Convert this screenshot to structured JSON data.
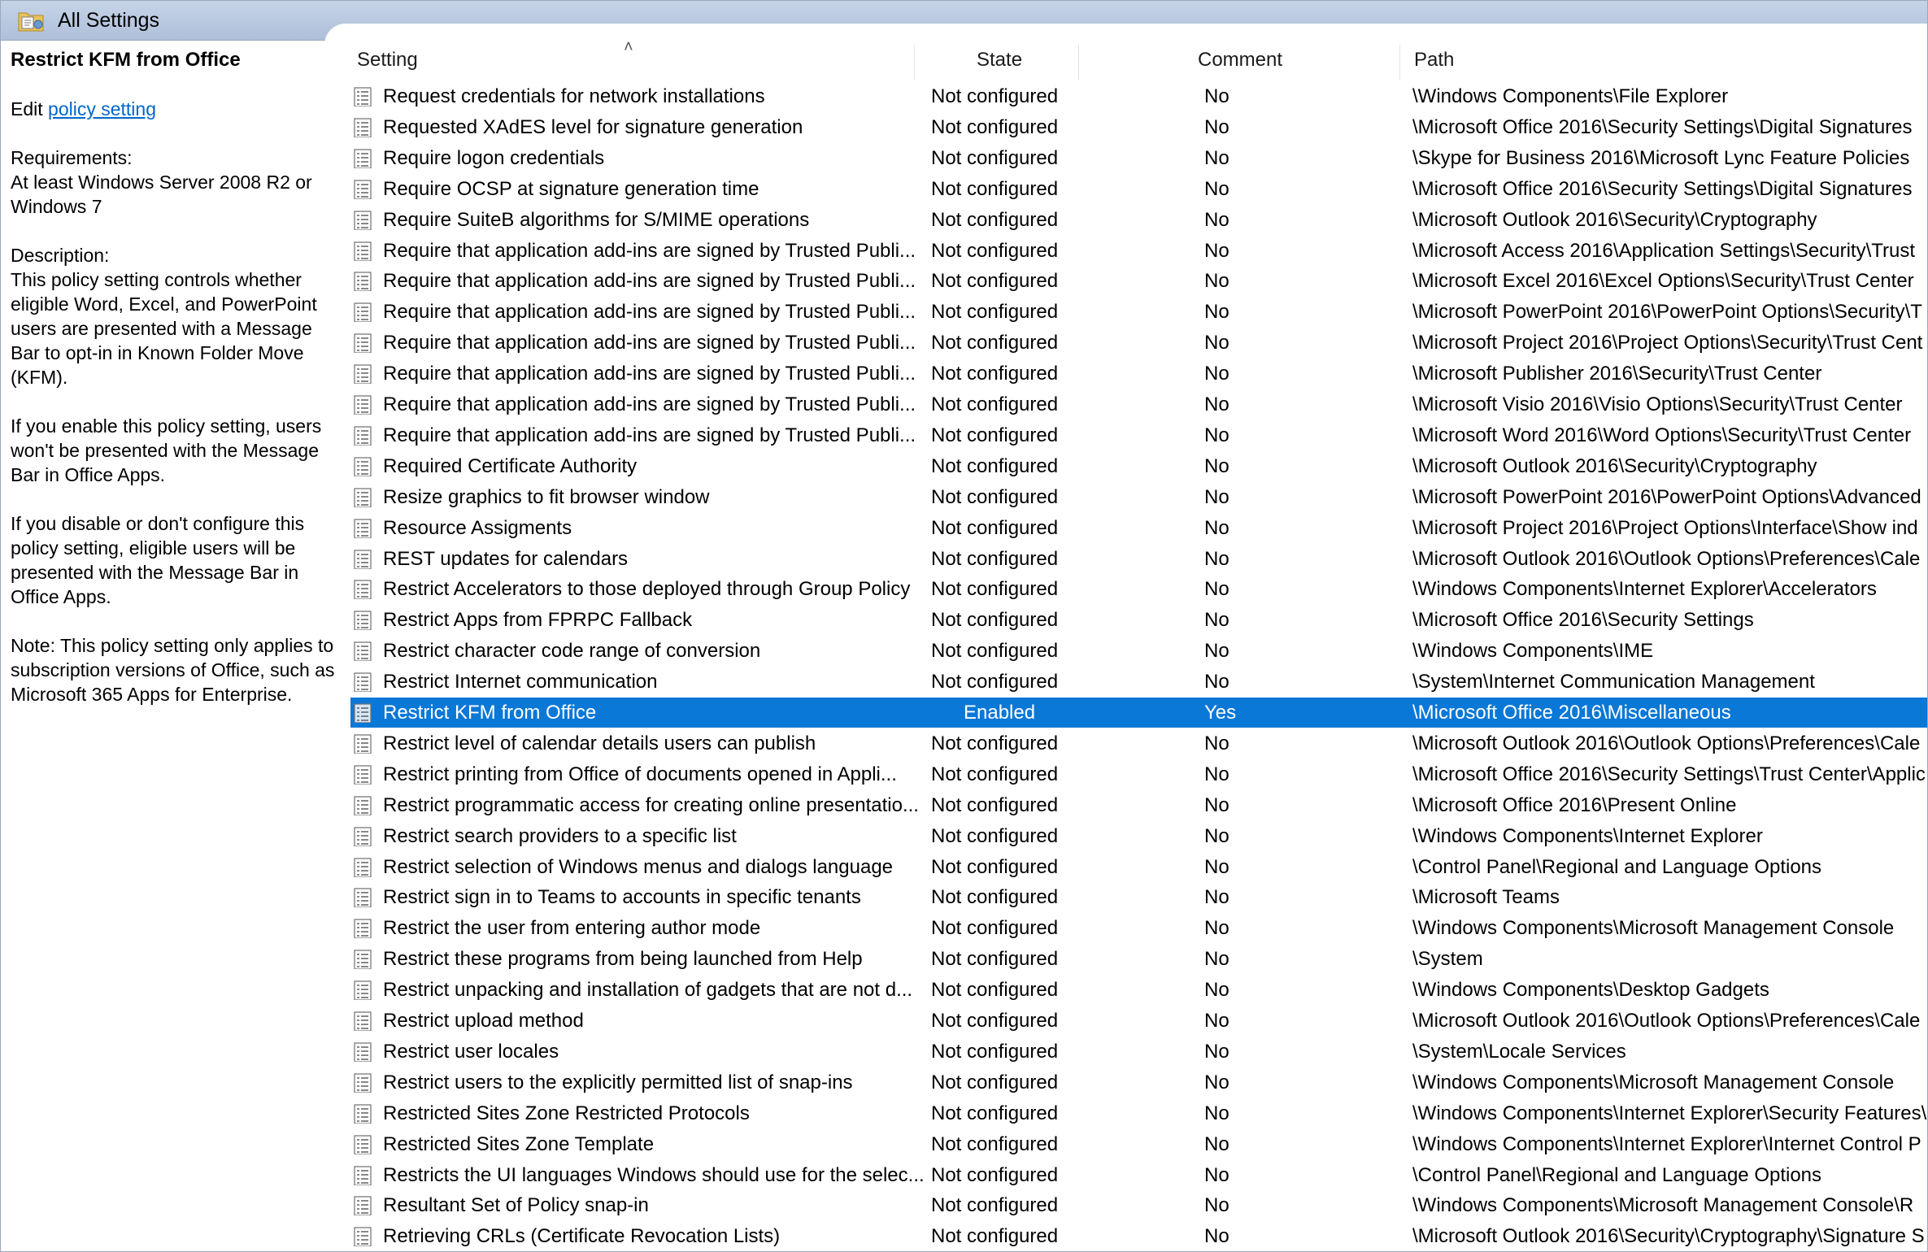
{
  "window": {
    "title": "All Settings",
    "icon": "policy-folder-icon"
  },
  "details": {
    "title": "Restrict KFM from Office",
    "edit_prefix": "Edit ",
    "edit_link": "policy setting",
    "requirements_label": "Requirements:",
    "requirements_text": "At least Windows Server 2008 R2 or Windows 7",
    "description_label": "Description:",
    "description_p1": "This policy setting controls whether eligible Word, Excel, and PowerPoint users are presented with a Message Bar to opt-in in Known Folder Move (KFM).",
    "description_p2": "If you enable this policy setting, users won't be presented with the Message Bar in Office Apps.",
    "description_p3": "If you disable or don't configure this policy setting, eligible users will be presented with the Message Bar in Office Apps.",
    "description_p4": "Note: This policy setting only applies to subscription versions of Office, such as Microsoft 365 Apps for Enterprise."
  },
  "columns": {
    "setting": "Setting",
    "state": "State",
    "comment": "Comment",
    "path": "Path"
  },
  "colors": {
    "selection": "#0a78d7",
    "titlebar": "#b9c9e2",
    "link": "#0066cc"
  },
  "rows": [
    {
      "setting": "Request credentials for network installations",
      "state": "Not configured",
      "comment": "No",
      "path": "\\Windows Components\\File Explorer"
    },
    {
      "setting": "Requested XAdES level for signature generation",
      "state": "Not configured",
      "comment": "No",
      "path": "\\Microsoft Office 2016\\Security Settings\\Digital Signatures"
    },
    {
      "setting": "Require logon credentials",
      "state": "Not configured",
      "comment": "No",
      "path": "\\Skype for Business 2016\\Microsoft Lync Feature Policies"
    },
    {
      "setting": "Require OCSP at signature generation time",
      "state": "Not configured",
      "comment": "No",
      "path": "\\Microsoft Office 2016\\Security Settings\\Digital Signatures"
    },
    {
      "setting": "Require SuiteB algorithms for S/MIME operations",
      "state": "Not configured",
      "comment": "No",
      "path": "\\Microsoft Outlook 2016\\Security\\Cryptography"
    },
    {
      "setting": "Require that application add-ins are signed by Trusted Publi...",
      "state": "Not configured",
      "comment": "No",
      "path": "\\Microsoft Access 2016\\Application Settings\\Security\\Trust"
    },
    {
      "setting": "Require that application add-ins are signed by Trusted Publi...",
      "state": "Not configured",
      "comment": "No",
      "path": "\\Microsoft Excel 2016\\Excel Options\\Security\\Trust Center"
    },
    {
      "setting": "Require that application add-ins are signed by Trusted Publi...",
      "state": "Not configured",
      "comment": "No",
      "path": "\\Microsoft PowerPoint 2016\\PowerPoint Options\\Security\\T"
    },
    {
      "setting": "Require that application add-ins are signed by Trusted Publi...",
      "state": "Not configured",
      "comment": "No",
      "path": "\\Microsoft Project 2016\\Project Options\\Security\\Trust Cent"
    },
    {
      "setting": "Require that application add-ins are signed by Trusted Publi...",
      "state": "Not configured",
      "comment": "No",
      "path": "\\Microsoft Publisher 2016\\Security\\Trust Center"
    },
    {
      "setting": "Require that application add-ins are signed by Trusted Publi...",
      "state": "Not configured",
      "comment": "No",
      "path": "\\Microsoft Visio 2016\\Visio Options\\Security\\Trust Center"
    },
    {
      "setting": "Require that application add-ins are signed by Trusted Publi...",
      "state": "Not configured",
      "comment": "No",
      "path": "\\Microsoft Word 2016\\Word Options\\Security\\Trust Center"
    },
    {
      "setting": "Required Certificate Authority",
      "state": "Not configured",
      "comment": "No",
      "path": "\\Microsoft Outlook 2016\\Security\\Cryptography"
    },
    {
      "setting": "Resize graphics to fit browser window",
      "state": "Not configured",
      "comment": "No",
      "path": "\\Microsoft PowerPoint 2016\\PowerPoint Options\\Advanced"
    },
    {
      "setting": "Resource Assigments",
      "state": "Not configured",
      "comment": "No",
      "path": "\\Microsoft Project 2016\\Project Options\\Interface\\Show ind"
    },
    {
      "setting": "REST updates for calendars",
      "state": "Not configured",
      "comment": "No",
      "path": "\\Microsoft Outlook 2016\\Outlook Options\\Preferences\\Cale"
    },
    {
      "setting": "Restrict Accelerators to those deployed through Group Policy",
      "state": "Not configured",
      "comment": "No",
      "path": "\\Windows Components\\Internet Explorer\\Accelerators"
    },
    {
      "setting": "Restrict Apps from FPRPC Fallback",
      "state": "Not configured",
      "comment": "No",
      "path": "\\Microsoft Office 2016\\Security Settings"
    },
    {
      "setting": "Restrict character code range of conversion",
      "state": "Not configured",
      "comment": "No",
      "path": "\\Windows Components\\IME"
    },
    {
      "setting": "Restrict Internet communication",
      "state": "Not configured",
      "comment": "No",
      "path": "\\System\\Internet Communication Management"
    },
    {
      "setting": "Restrict KFM from Office",
      "state": "Enabled",
      "comment": "Yes",
      "path": "\\Microsoft Office 2016\\Miscellaneous",
      "selected": true
    },
    {
      "setting": "Restrict level of calendar details users can publish",
      "state": "Not configured",
      "comment": "No",
      "path": "\\Microsoft Outlook 2016\\Outlook Options\\Preferences\\Cale"
    },
    {
      "setting": "Restrict printing from Office of documents opened in Appli...",
      "state": "Not configured",
      "comment": "No",
      "path": "\\Microsoft Office 2016\\Security Settings\\Trust Center\\Applic"
    },
    {
      "setting": "Restrict programmatic access for creating online presentatio...",
      "state": "Not configured",
      "comment": "No",
      "path": "\\Microsoft Office 2016\\Present Online"
    },
    {
      "setting": "Restrict search providers to a specific list",
      "state": "Not configured",
      "comment": "No",
      "path": "\\Windows Components\\Internet Explorer"
    },
    {
      "setting": "Restrict selection of Windows menus and dialogs language",
      "state": "Not configured",
      "comment": "No",
      "path": "\\Control Panel\\Regional and Language Options"
    },
    {
      "setting": "Restrict sign in to Teams to accounts in specific tenants",
      "state": "Not configured",
      "comment": "No",
      "path": "\\Microsoft Teams"
    },
    {
      "setting": "Restrict the user from entering author mode",
      "state": "Not configured",
      "comment": "No",
      "path": "\\Windows Components\\Microsoft Management Console"
    },
    {
      "setting": "Restrict these programs from being launched from Help",
      "state": "Not configured",
      "comment": "No",
      "path": "\\System"
    },
    {
      "setting": "Restrict unpacking and installation of gadgets that are not d...",
      "state": "Not configured",
      "comment": "No",
      "path": "\\Windows Components\\Desktop Gadgets"
    },
    {
      "setting": "Restrict upload method",
      "state": "Not configured",
      "comment": "No",
      "path": "\\Microsoft Outlook 2016\\Outlook Options\\Preferences\\Cale"
    },
    {
      "setting": "Restrict user locales",
      "state": "Not configured",
      "comment": "No",
      "path": "\\System\\Locale Services"
    },
    {
      "setting": "Restrict users to the explicitly permitted list of snap-ins",
      "state": "Not configured",
      "comment": "No",
      "path": "\\Windows Components\\Microsoft Management Console"
    },
    {
      "setting": "Restricted Sites Zone Restricted Protocols",
      "state": "Not configured",
      "comment": "No",
      "path": "\\Windows Components\\Internet Explorer\\Security Features\\"
    },
    {
      "setting": "Restricted Sites Zone Template",
      "state": "Not configured",
      "comment": "No",
      "path": "\\Windows Components\\Internet Explorer\\Internet Control P"
    },
    {
      "setting": "Restricts the UI languages Windows should use for the selec...",
      "state": "Not configured",
      "comment": "No",
      "path": "\\Control Panel\\Regional and Language Options"
    },
    {
      "setting": "Resultant Set of Policy snap-in",
      "state": "Not configured",
      "comment": "No",
      "path": "\\Windows Components\\Microsoft Management Console\\R"
    },
    {
      "setting": "Retrieving CRLs (Certificate Revocation Lists)",
      "state": "Not configured",
      "comment": "No",
      "path": "\\Microsoft Outlook 2016\\Security\\Cryptography\\Signature S"
    }
  ]
}
